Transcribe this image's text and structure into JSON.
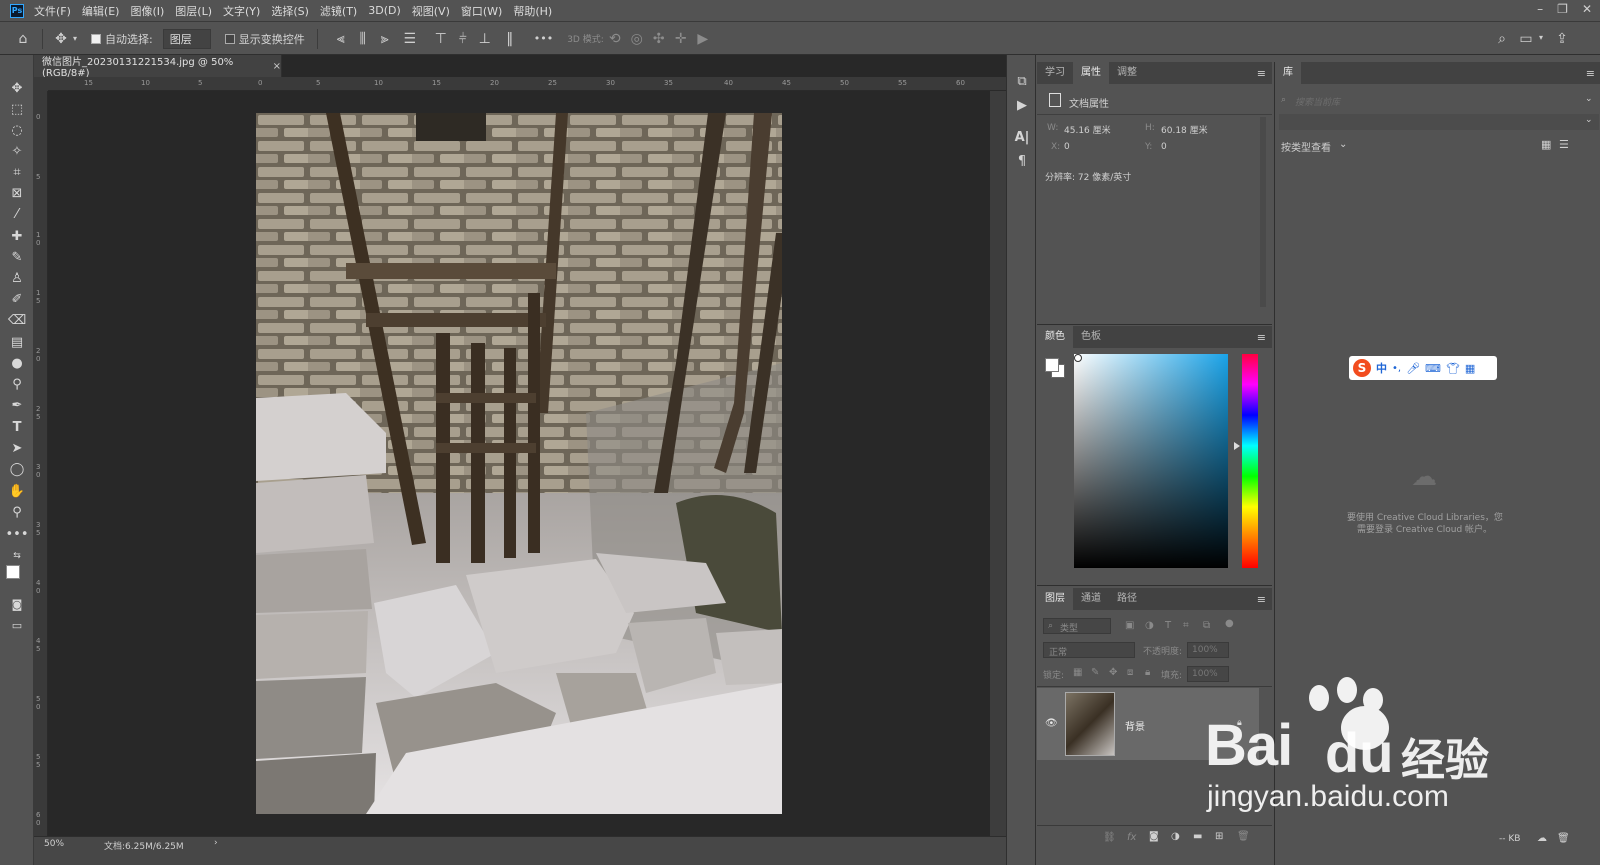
{
  "menubar": {
    "logo": "Ps",
    "items": [
      "文件(F)",
      "编辑(E)",
      "图像(I)",
      "图层(L)",
      "文字(Y)",
      "选择(S)",
      "滤镜(T)",
      "3D(D)",
      "视图(V)",
      "窗口(W)",
      "帮助(H)"
    ]
  },
  "optbar": {
    "auto_select_label": "自动选择:",
    "auto_select_target": "图层",
    "show_transform_label": "显示变换控件",
    "more": "•••",
    "mode_3d_label": "3D 模式:"
  },
  "document": {
    "tab_title": "微信图片_20230131221534.jpg @ 50%(RGB/8#)",
    "tab_close": "×",
    "ruler_top": [
      "15",
      "10",
      "5",
      "0",
      "5",
      "10",
      "15",
      "20",
      "25",
      "30",
      "35",
      "40",
      "45",
      "50",
      "55",
      "60"
    ],
    "ruler_left": [
      "0",
      "5",
      "1 0",
      "1 5",
      "2 0",
      "2 5",
      "3 0",
      "3 5",
      "4 0",
      "4 5",
      "5 0",
      "5 5",
      "6 0"
    ],
    "zoom": "50%",
    "doc_size": "文档:6.25M/6.25M",
    "status_arrow": "›"
  },
  "properties_panel": {
    "tabs": [
      "学习",
      "属性",
      "调整"
    ],
    "active_tab": "属性",
    "section_title": "文档属性",
    "w_label": "W:",
    "w_value": "45.16 厘米",
    "h_label": "H:",
    "h_value": "60.18 厘米",
    "x_label": "X:",
    "x_value": "0",
    "y_label": "Y:",
    "y_value": "0",
    "resolution": "分辨率: 72 像素/英寸"
  },
  "color_panel": {
    "tabs": [
      "颜色",
      "色板"
    ],
    "active_tab": "颜色",
    "gradient_color": "#1aa3e8"
  },
  "layers_panel": {
    "tabs": [
      "图层",
      "通道",
      "路径"
    ],
    "active_tab": "图层",
    "filter_placeholder": "类型",
    "blend_mode": "正常",
    "opacity_label": "不透明度:",
    "opacity_value": "100%",
    "lock_label": "锁定:",
    "fill_label": "填充:",
    "fill_value": "100%",
    "layers": [
      {
        "name": "背景",
        "visible": true
      }
    ]
  },
  "library_panel": {
    "tab": "库",
    "search_placeholder": "搜索当前库",
    "view_by": "按类型查看",
    "message_line1": "要使用 Creative Cloud Libraries，您",
    "message_line2": "需要登录 Creative Cloud 帐户。",
    "footer_kb": "-- KB"
  },
  "ime_bar": {
    "label": "中"
  },
  "watermark": {
    "brand_left": "Bai",
    "brand_right": "经验",
    "url": "jingyan.baidu.com"
  }
}
